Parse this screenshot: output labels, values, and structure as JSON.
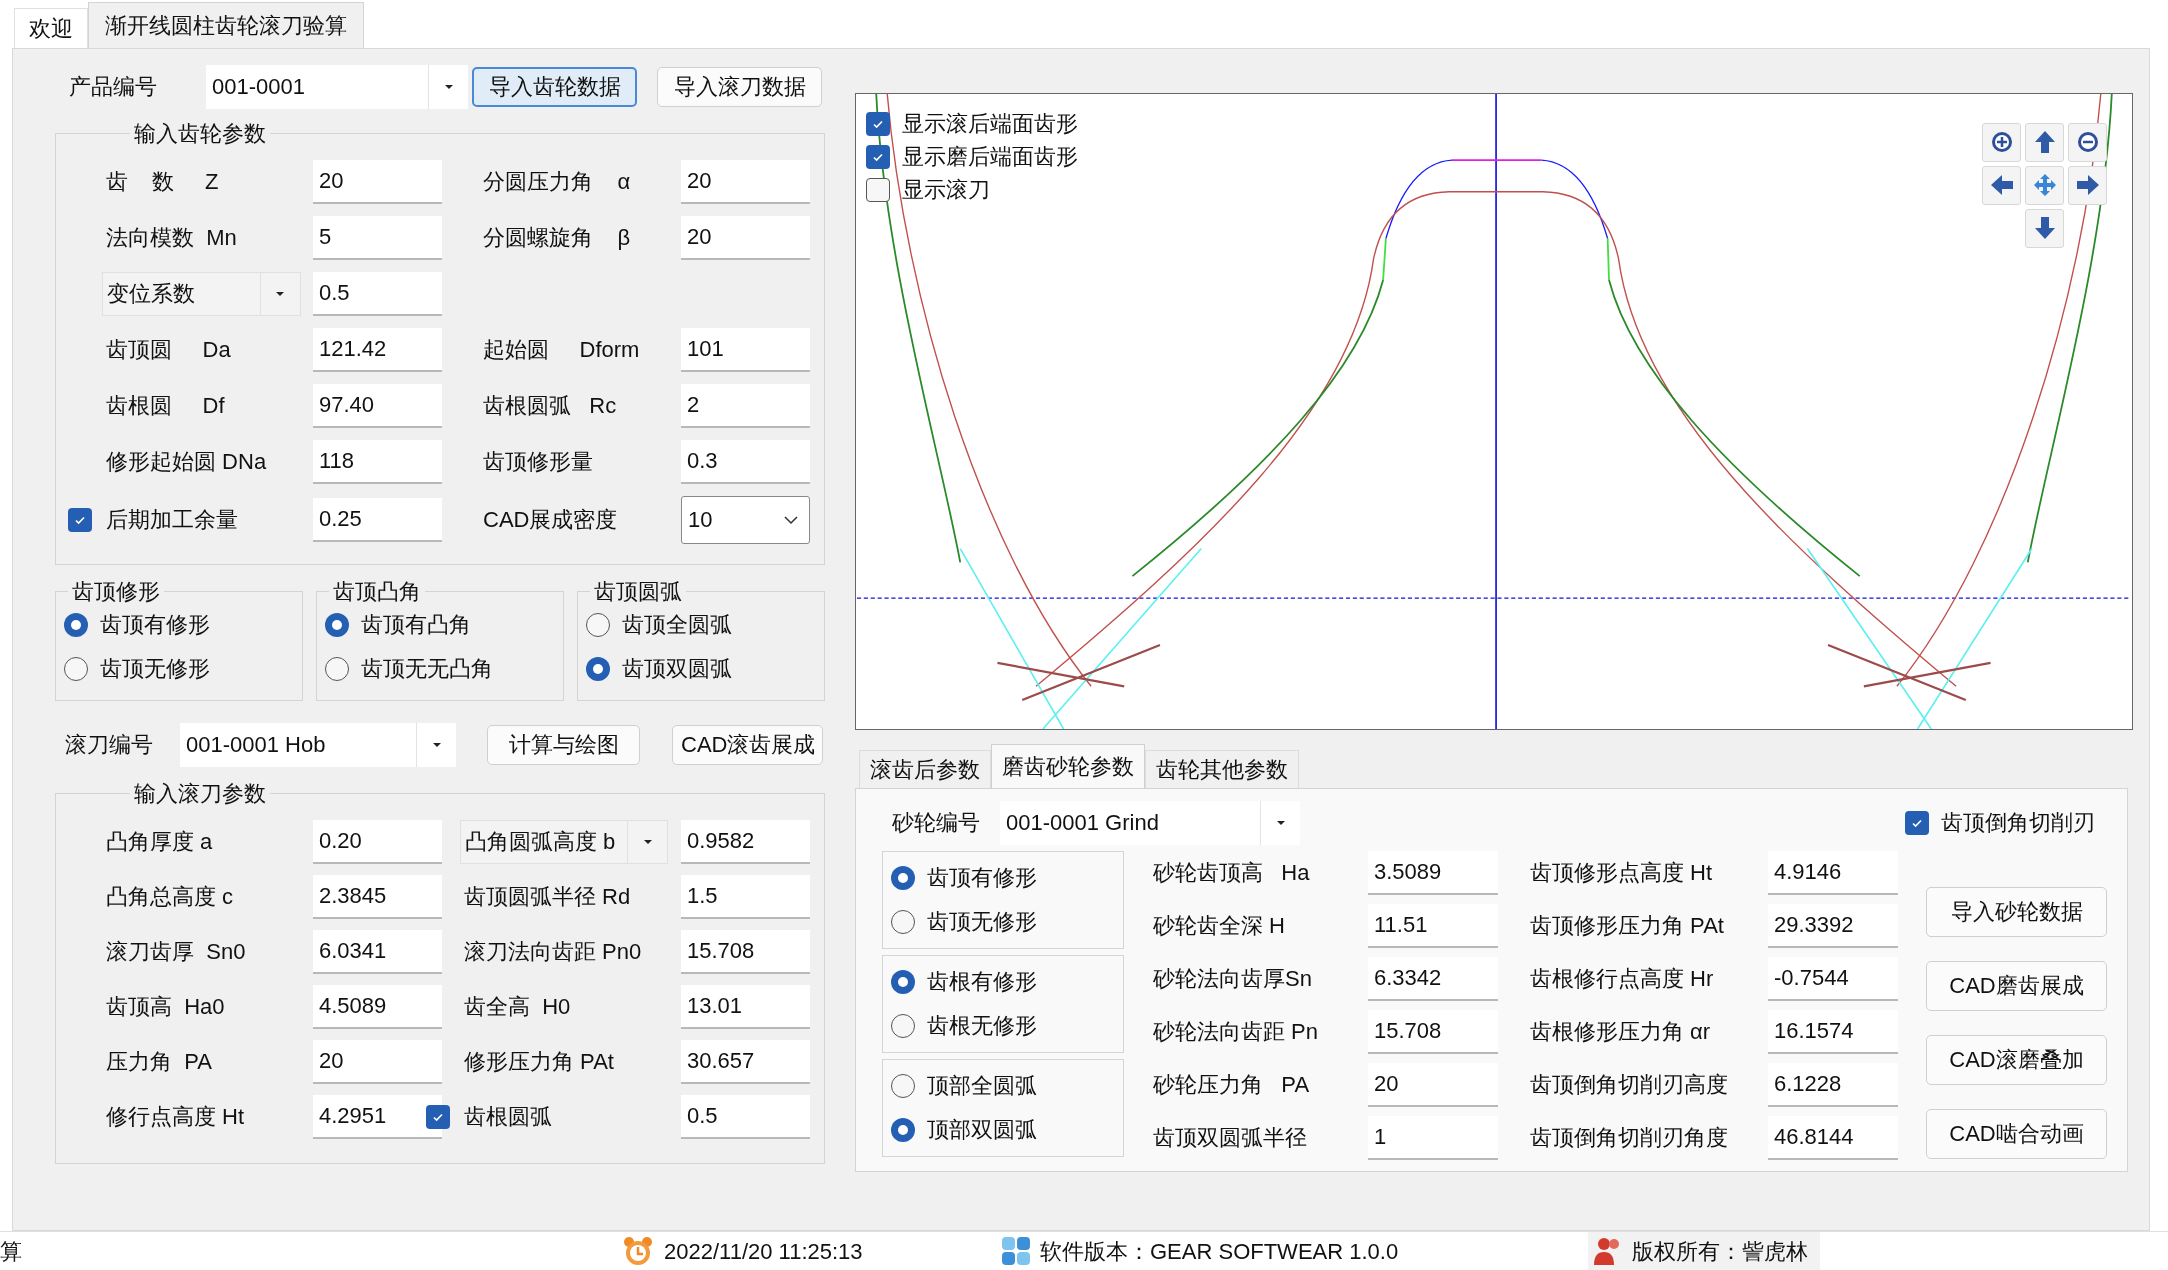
{
  "tabs": [
    {
      "label": "欢迎",
      "selected": false
    },
    {
      "label": "渐开线圆柱齿轮滚刀验算",
      "selected": true
    }
  ],
  "product": {
    "label": "产品编号",
    "value": "001-0001"
  },
  "gear_buttons": [
    {
      "label": "导入齿轮数据",
      "focused": true
    },
    {
      "label": "导入滚刀数据",
      "focused": false
    }
  ],
  "gear_params": {
    "title": "输入齿轮参数",
    "rows": [
      {
        "left": {
          "kind": "text",
          "label": "齿    数     Z",
          "value": "20"
        },
        "right": {
          "kind": "text",
          "label": "分圆压力角    α",
          "value": "20"
        }
      },
      {
        "left": {
          "kind": "text",
          "label": "法向模数  Mn",
          "value": "5"
        },
        "right": {
          "kind": "text",
          "label": "分圆螺旋角    β",
          "value": "20"
        }
      },
      {
        "left": {
          "kind": "select_label",
          "label": "变位系数",
          "value": "0.5"
        }
      },
      {
        "left": {
          "kind": "text",
          "label": "齿顶圆     Da",
          "value": "121.42"
        },
        "right": {
          "kind": "text",
          "label": "起始圆     Dform",
          "value": "101"
        }
      },
      {
        "left": {
          "kind": "text",
          "label": "齿根圆     Df",
          "value": "97.40"
        },
        "right": {
          "kind": "text",
          "label": "齿根圆弧   Rc",
          "value": "2"
        }
      },
      {
        "left": {
          "kind": "text",
          "label": "修形起始圆 DNa",
          "value": "118"
        },
        "right": {
          "kind": "text",
          "label": "齿顶修形量",
          "value": "0.3"
        }
      },
      {
        "left": {
          "kind": "check",
          "label": "后期加工余量",
          "checked": true,
          "value": "0.25"
        },
        "right": {
          "kind": "select_value",
          "label": "CAD展成密度",
          "value": "10"
        }
      }
    ]
  },
  "tip_groups": [
    {
      "title": "齿顶修形",
      "options": [
        {
          "label": "齿顶有修形",
          "selected": true
        },
        {
          "label": "齿顶无修形",
          "selected": false
        }
      ]
    },
    {
      "title": "齿顶凸角",
      "options": [
        {
          "label": "齿顶有凸角",
          "selected": true
        },
        {
          "label": "齿顶无无凸角",
          "selected": false
        }
      ]
    },
    {
      "title": "齿顶圆弧",
      "options": [
        {
          "label": "齿顶全圆弧",
          "selected": false
        },
        {
          "label": "齿顶双圆弧",
          "selected": true
        }
      ]
    }
  ],
  "hob": {
    "label": "滚刀编号",
    "value": "001-0001 Hob"
  },
  "hob_buttons": [
    "计算与绘图",
    "CAD滚齿展成"
  ],
  "hob_params": {
    "title": "输入滚刀参数",
    "rows": [
      {
        "left": {
          "kind": "text",
          "label": "凸角厚度 a",
          "value": "0.20"
        },
        "right": {
          "kind": "select_label",
          "label": "凸角圆弧高度 b",
          "value": "0.9582"
        }
      },
      {
        "left": {
          "kind": "text",
          "label": "凸角总高度 c",
          "value": "2.3845"
        },
        "right": {
          "kind": "text",
          "label": "齿顶圆弧半径 Rd",
          "value": "1.5"
        }
      },
      {
        "left": {
          "kind": "text",
          "label": "滚刀齿厚  Sn0",
          "value": "6.0341"
        },
        "right": {
          "kind": "text",
          "label": "滚刀法向齿距 Pn0",
          "value": "15.708"
        }
      },
      {
        "left": {
          "kind": "text",
          "label": "齿顶高  Ha0",
          "value": "4.5089"
        },
        "right": {
          "kind": "text",
          "label": "齿全高  H0",
          "value": "13.01"
        }
      },
      {
        "left": {
          "kind": "text",
          "label": "压力角  PA",
          "value": "20"
        },
        "right": {
          "kind": "text",
          "label": "修形压力角 PAt",
          "value": "30.657"
        }
      },
      {
        "left": {
          "kind": "text",
          "label": "修行点高度 Ht",
          "value": "4.2951"
        },
        "right": {
          "kind": "check",
          "label": "齿根圆弧",
          "checked": true,
          "value": "0.5"
        }
      }
    ]
  },
  "chart_options": [
    {
      "label": "显示滚后端面齿形",
      "checked": true
    },
    {
      "label": "显示磨后端面齿形",
      "checked": true
    },
    {
      "label": "显示滚刀",
      "checked": false
    }
  ],
  "bottom_tabs": [
    {
      "label": "滚齿后参数",
      "selected": false
    },
    {
      "label": "磨齿砂轮参数",
      "selected": true
    },
    {
      "label": "齿轮其他参数",
      "selected": false
    }
  ],
  "grind": {
    "label": "砂轮编号",
    "value": "001-0001 Grind",
    "chamfer": {
      "label": "齿顶倒角切削刃",
      "checked": true
    },
    "radio_groups": [
      [
        {
          "label": "齿顶有修形",
          "selected": true
        },
        {
          "label": "齿顶无修形",
          "selected": false
        }
      ],
      [
        {
          "label": "齿根有修形",
          "selected": true
        },
        {
          "label": "齿根无修形",
          "selected": false
        }
      ],
      [
        {
          "label": "顶部全圆弧",
          "selected": false
        },
        {
          "label": "顶部双圆弧",
          "selected": true
        }
      ]
    ],
    "rows": [
      {
        "left": {
          "label": "砂轮齿顶高   Ha",
          "value": "3.5089"
        },
        "right": {
          "label": "齿顶修形点高度 Ht",
          "value": "4.9146"
        }
      },
      {
        "left": {
          "label": "砂轮齿全深 H",
          "value": "11.51"
        },
        "right": {
          "label": "齿顶修形压力角 PAt",
          "value": "29.3392"
        }
      },
      {
        "left": {
          "label": "砂轮法向齿厚Sn",
          "value": "6.3342"
        },
        "right": {
          "label": "齿根修行点高度 Hr",
          "value": "-0.7544"
        }
      },
      {
        "left": {
          "label": "砂轮法向齿距 Pn",
          "value": "15.708"
        },
        "right": {
          "label": "齿根修形压力角 αr",
          "value": "16.1574"
        }
      },
      {
        "left": {
          "label": "砂轮压力角   PA",
          "value": "20"
        },
        "right": {
          "label": "齿顶倒角切削刃高度",
          "value": "6.1228"
        }
      },
      {
        "left": {
          "label": "齿顶双圆弧半径",
          "value": "1"
        },
        "right": {
          "label": "齿顶倒角切削刃角度",
          "value": "46.8144"
        }
      }
    ],
    "buttons": [
      "导入砂轮数据",
      "CAD磨齿展成",
      "CAD滚磨叠加",
      "CAD啮合动画"
    ]
  },
  "status_bar": {
    "left_text": "算",
    "datetime": "2022/11/20 11:25:13",
    "version": "软件版本：GEAR SOFTWEAR 1.0.0",
    "copyright": "版权所有：訾虎林"
  }
}
